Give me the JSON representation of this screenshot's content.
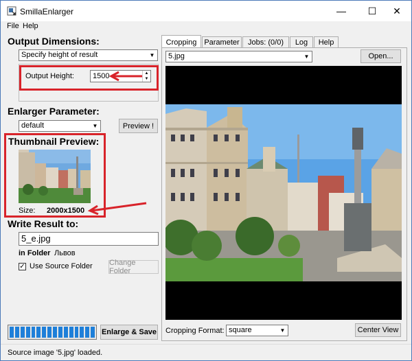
{
  "window": {
    "title": "SmillaEnlarger",
    "min": "—",
    "max": "☐",
    "close": "✕"
  },
  "menu": {
    "file": "File",
    "help": "Help"
  },
  "output": {
    "title": "Output Dimensions:",
    "mode": "Specify height of result",
    "height_label": "Output Height:",
    "height_value": "1500"
  },
  "enlarger": {
    "title": "Enlarger Parameter:",
    "preset": "default",
    "preview_btn": "Preview !"
  },
  "thumbnail": {
    "title": "Thumbnail Preview:",
    "size_label": "Size:",
    "size_value": "2000x1500"
  },
  "write": {
    "title": "Write Result to:",
    "filename": "5_e.jpg",
    "in_folder_label": "in Folder",
    "folder": "Львов",
    "use_source_label": "Use Source Folder",
    "use_source_checked": true,
    "change_folder_btn": "Change Folder"
  },
  "tabs": [
    {
      "label": "Cropping",
      "active": true
    },
    {
      "label": "Parameter",
      "active": false
    },
    {
      "label": "Jobs: (0/0)",
      "active": false
    },
    {
      "label": "Log",
      "active": false
    },
    {
      "label": "Help",
      "active": false
    }
  ],
  "cropping": {
    "image_file": "5.jpg",
    "open_btn": "Open...",
    "format_label": "Cropping Format:",
    "format_value": "square",
    "center_btn": "Center View"
  },
  "progress": {
    "value": 1.0
  },
  "enlarge_btn": "Enlarge & Save",
  "status": "Source image '5.jpg' loaded.",
  "colors": {
    "accent": "#1e7fd9",
    "highlight": "#d8232a"
  }
}
